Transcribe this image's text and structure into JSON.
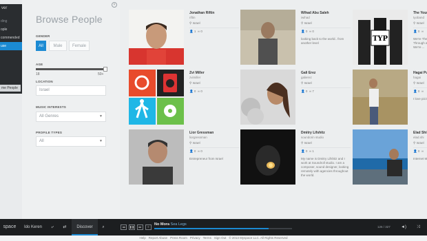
{
  "drawer": {
    "header": "ver",
    "items": [
      {
        "label": "ding",
        "state": "dim"
      },
      {
        "label": "ople",
        "state": "normal"
      },
      {
        "label": "commended",
        "state": "normal"
      },
      {
        "label": "use",
        "state": "active"
      },
      {
        "label": "",
        "state": "dim"
      },
      {
        "label": "",
        "state": "dim"
      },
      {
        "label": "",
        "state": "dim"
      }
    ],
    "button_label": "me People"
  },
  "filters": {
    "title": "Browse People",
    "gender_label": "GENDER",
    "gender_options": [
      "All",
      "Male",
      "Female"
    ],
    "gender_selected": "All",
    "age_label": "AGE",
    "age_min": "18",
    "age_max": "50+",
    "location_label": "LOCATION",
    "location_value": "Israel",
    "music_label": "MUSIC INTERESTS",
    "music_value": "All Genres",
    "profile_label": "PROFILE TYPES",
    "profile_value": "All"
  },
  "people": [
    {
      "name": "Jonathan Riftin",
      "handle": "riftin",
      "location": "Israel",
      "followers": "1",
      "connections": "0",
      "bio": "",
      "photo": "red"
    },
    {
      "name": "Wihad Abu Saleh",
      "handle": "iwihad",
      "location": "Israel",
      "followers": "0",
      "connections": "0",
      "bio": "looking back to the world.. from another level",
      "photo": "stone"
    },
    {
      "name": "The Young Professionals",
      "handle": "tyoband",
      "location": "Israel",
      "followers": "0",
      "connections": "",
      "bio": "We're The Young Professionals. Through a mix of ... and materials. We're ...",
      "photo": "bw"
    },
    {
      "name": "Zvi Miller",
      "handle": "zvimiller",
      "location": "Israel",
      "followers": "0",
      "connections": "0",
      "bio": "",
      "photo": "tiles"
    },
    {
      "name": "Gali Erez",
      "handle": "galierez",
      "location": "Israel",
      "followers": "0",
      "connections": "7",
      "bio": "",
      "photo": "girl"
    },
    {
      "name": "Hagai Pu",
      "handle": "hagai",
      "location": "Israel",
      "followers": "0",
      "connections": "",
      "bio": "I love pizza",
      "photo": "field"
    },
    {
      "name": "Lior Gressman",
      "handle": "liorgressman",
      "location": "Israel",
      "followers": "0",
      "connections": "0",
      "bio": "Entrepreneur from Israel",
      "photo": "man"
    },
    {
      "name": "Dmitry Lifshitz",
      "handle": "soundorin studio",
      "location": "Israel",
      "followers": "0",
      "connections": "1",
      "bio": "My name is Dmitry Lifshitz and I work at Soundroll studio. I am a composer, sound designer, looking remotely with agencies throughout the world.",
      "photo": "dark"
    },
    {
      "name": "Elad Shi",
      "handle": "elad.shi",
      "location": "Israel",
      "followers": "0",
      "connections": "",
      "bio": "Internet M... Big Music...",
      "photo": "sea"
    }
  ],
  "player": {
    "logo": "space",
    "user": "Ido Keren",
    "discover": "Discover",
    "track": "No Mora",
    "artist": "Sea Legs",
    "progress": 0.83,
    "count": "126 / 327"
  },
  "footer": {
    "links": [
      "Help",
      "Report Abuse",
      "Press Room",
      "Privacy",
      "Terms",
      "Sign Out",
      "© 2013 Myspace LLC. All Rights Reserved"
    ]
  },
  "colors": {
    "accent": "#1b8ad3",
    "bar": "#1c1e20"
  }
}
